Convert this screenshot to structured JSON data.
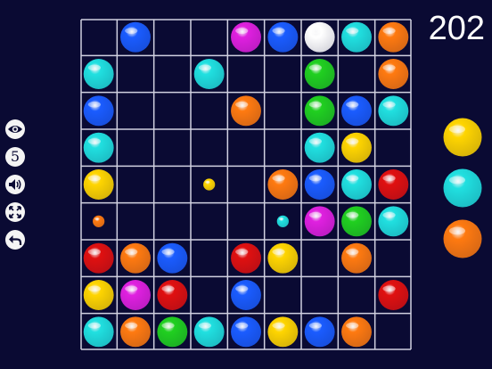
{
  "score": "202",
  "controls": {
    "five_label": "5"
  },
  "colors": {
    "grid_line": "#d0d0e0",
    "background": "#0a0a33",
    "blue": "#1a5cff",
    "magenta": "#e020e0",
    "white": "#ffffff",
    "cyan": "#20e0e0",
    "orange": "#ff7a10",
    "green": "#20d020",
    "yellow": "#ffd500",
    "red": "#e01010"
  },
  "board": {
    "rows": 9,
    "cols": 9,
    "cells": [
      [
        "",
        "blue",
        "",
        "",
        "magenta",
        "blue",
        "white",
        "cyan",
        "orange"
      ],
      [
        "cyan",
        "",
        "",
        "cyan",
        "",
        "",
        "green",
        "",
        "orange"
      ],
      [
        "blue",
        "",
        "",
        "",
        "orange",
        "",
        "green",
        "blue",
        "cyan"
      ],
      [
        "cyan",
        "",
        "",
        "",
        "",
        "",
        "cyan",
        "yellow",
        ""
      ],
      [
        "yellow",
        "",
        "",
        "",
        "",
        "orange",
        "blue",
        "cyan",
        "red"
      ],
      [
        "",
        "",
        "",
        "",
        "",
        "",
        "magenta",
        "green",
        "cyan"
      ],
      [
        "red",
        "orange",
        "blue",
        "",
        "red",
        "yellow",
        "",
        "orange",
        ""
      ],
      [
        "yellow",
        "magenta",
        "red",
        "",
        "blue",
        "",
        "",
        "",
        "red"
      ],
      [
        "cyan",
        "orange",
        "green",
        "cyan",
        "blue",
        "yellow",
        "blue",
        "orange",
        ""
      ]
    ],
    "preview": [
      {
        "row": 4,
        "col": 3,
        "color": "yellow"
      },
      {
        "row": 5,
        "col": 0,
        "color": "orange"
      },
      {
        "row": 5,
        "col": 5,
        "color": "cyan"
      }
    ]
  },
  "next_balls": [
    "yellow",
    "cyan",
    "orange"
  ]
}
